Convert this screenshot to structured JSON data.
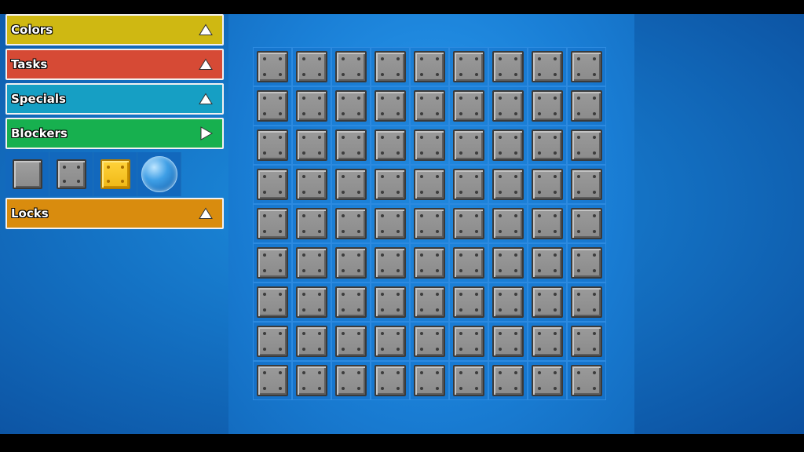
{
  "sections": [
    {
      "label": "Colors",
      "color": "#cfb812",
      "state": "expanded"
    },
    {
      "label": "Tasks",
      "color": "#d64a35",
      "state": "expanded"
    },
    {
      "label": "Specials",
      "color": "#169fc4",
      "state": "expanded"
    },
    {
      "label": "Blockers",
      "color": "#17b04f",
      "state": "collapsed"
    }
  ],
  "blockers_items": [
    "plain-block-icon",
    "riveted-block-icon",
    "gold-block-icon",
    "bubble-icon"
  ],
  "locks": {
    "label": "Locks",
    "color": "#d98c0e",
    "state": "expanded"
  },
  "board": {
    "rows": 9,
    "cols": 9,
    "tile": "riveted-metal-block"
  }
}
